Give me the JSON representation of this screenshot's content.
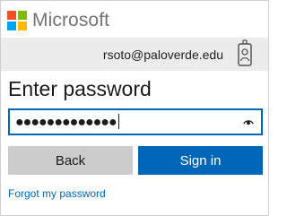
{
  "brand": {
    "name": "Microsoft",
    "logo_colors": [
      "#f25022",
      "#7fba00",
      "#00a4ef",
      "#ffb900"
    ],
    "logo_icon": "microsoft-logo-icon"
  },
  "account": {
    "email": "rsoto@paloverde.edu",
    "icon": "id-badge-icon"
  },
  "page": {
    "heading": "Enter password"
  },
  "password_field": {
    "value": "●●●●●●●●●●●●●",
    "reveal_icon": "eye-icon"
  },
  "buttons": {
    "back_label": "Back",
    "signin_label": "Sign in"
  },
  "links": {
    "forgot_password": "Forgot my password"
  },
  "colors": {
    "accent": "#0067b8",
    "band": "#ececec",
    "back_button": "#cccccc",
    "brand_text": "#737373"
  }
}
